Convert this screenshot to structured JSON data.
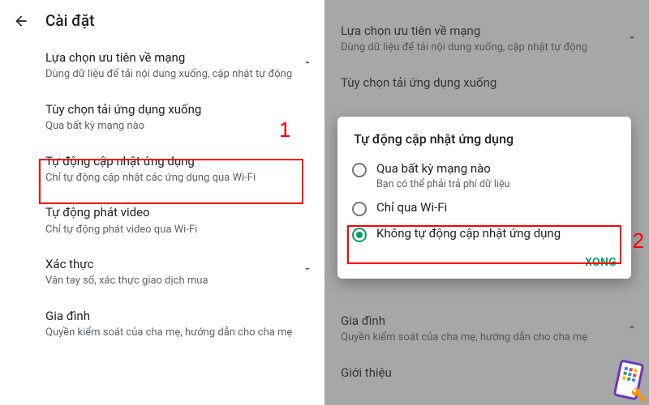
{
  "left": {
    "header_title": "Cài đặt",
    "items": [
      {
        "title": "Lựa chọn ưu tiên về mạng",
        "sub": "Dùng dữ liệu để tải nội dung xuống, cập nhật tự động",
        "chevron": true
      },
      {
        "title": "Tùy chọn tải ứng dụng xuống",
        "sub": "Qua bất kỳ mạng nào"
      },
      {
        "title": "Tự động cập nhật ứng dụng",
        "sub": "Chỉ tự động cập nhật các ứng dụng qua Wi-Fi"
      },
      {
        "title": "Tự động phát video",
        "sub": "Chỉ tự động phát video qua Wi-Fi"
      },
      {
        "title": "Xác thực",
        "sub": "Vân tay số, xác thực giao dịch mua",
        "chevron": true
      },
      {
        "title": "Gia đình",
        "sub": "Quyền kiểm soát của cha mẹ, hướng dẫn cho cha mẹ"
      }
    ],
    "annotation1": "1"
  },
  "right": {
    "bg_items": [
      {
        "title": "Lựa chọn ưu tiên về mạng",
        "sub": "Dùng dữ liệu để tải nội dung xuống, cập nhật tự động",
        "chevron": true
      },
      {
        "title": "Tùy chọn tải ứng dụng xuống",
        "sub": ""
      },
      {
        "title": "Gia đình",
        "sub": "Quyền kiểm soát của cha mẹ, hướng dẫn cho cha mẹ",
        "chevron": true
      },
      {
        "title": "Giới thiệu",
        "sub": ""
      }
    ],
    "dialog": {
      "title": "Tự động cập nhật ứng dụng",
      "options": [
        {
          "label": "Qua bất kỳ mạng nào",
          "sub": "Bạn có thể phải trả phí dữ liệu",
          "selected": false
        },
        {
          "label": "Chỉ qua Wi-Fi",
          "sub": "",
          "selected": false
        },
        {
          "label": "Không tự động cập nhật ứng dụng",
          "sub": "",
          "selected": true
        }
      ],
      "action": "XONG"
    },
    "annotation2": "2"
  }
}
